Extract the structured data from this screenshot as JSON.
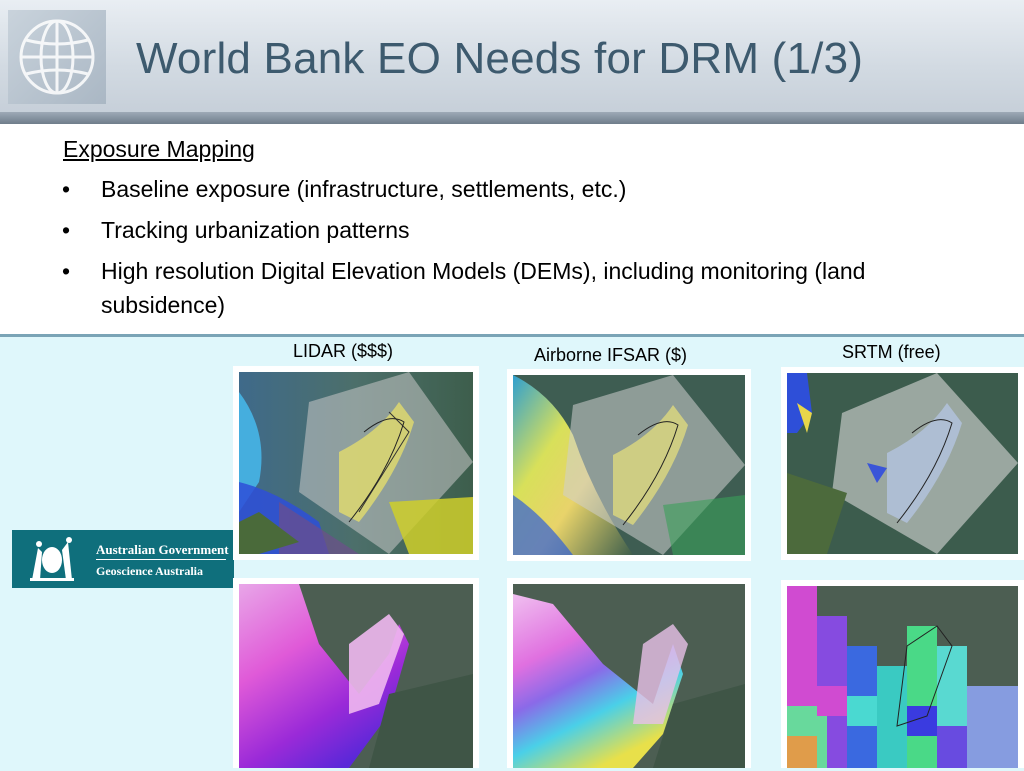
{
  "slide": {
    "title": "World Bank EO Needs for DRM (1/3)",
    "section_heading": "Exposure Mapping",
    "bullet_glyph": "•",
    "bullets": [
      "Baseline exposure (infrastructure, settlements, etc.)",
      "Tracking urbanization patterns",
      "High resolution Digital Elevation Models (DEMs), including monitoring (land subsidence)"
    ]
  },
  "comparison": {
    "columns": [
      {
        "label": "LIDAR ($$$)"
      },
      {
        "label": "Airborne IFSAR ($)"
      },
      {
        "label": "SRTM (free)"
      }
    ]
  },
  "agency_logo": {
    "line1": "Australian Government",
    "line2": "Geoscience Australia"
  },
  "icons": {
    "world_bank_logo": "globe-icon",
    "coat_of_arms": "crest-icon"
  },
  "colors": {
    "title": "#3d5a6e",
    "panel_background": "#dff7fb",
    "agency_logo_background": "#0f6f7c",
    "header_band": "#7a8896"
  }
}
